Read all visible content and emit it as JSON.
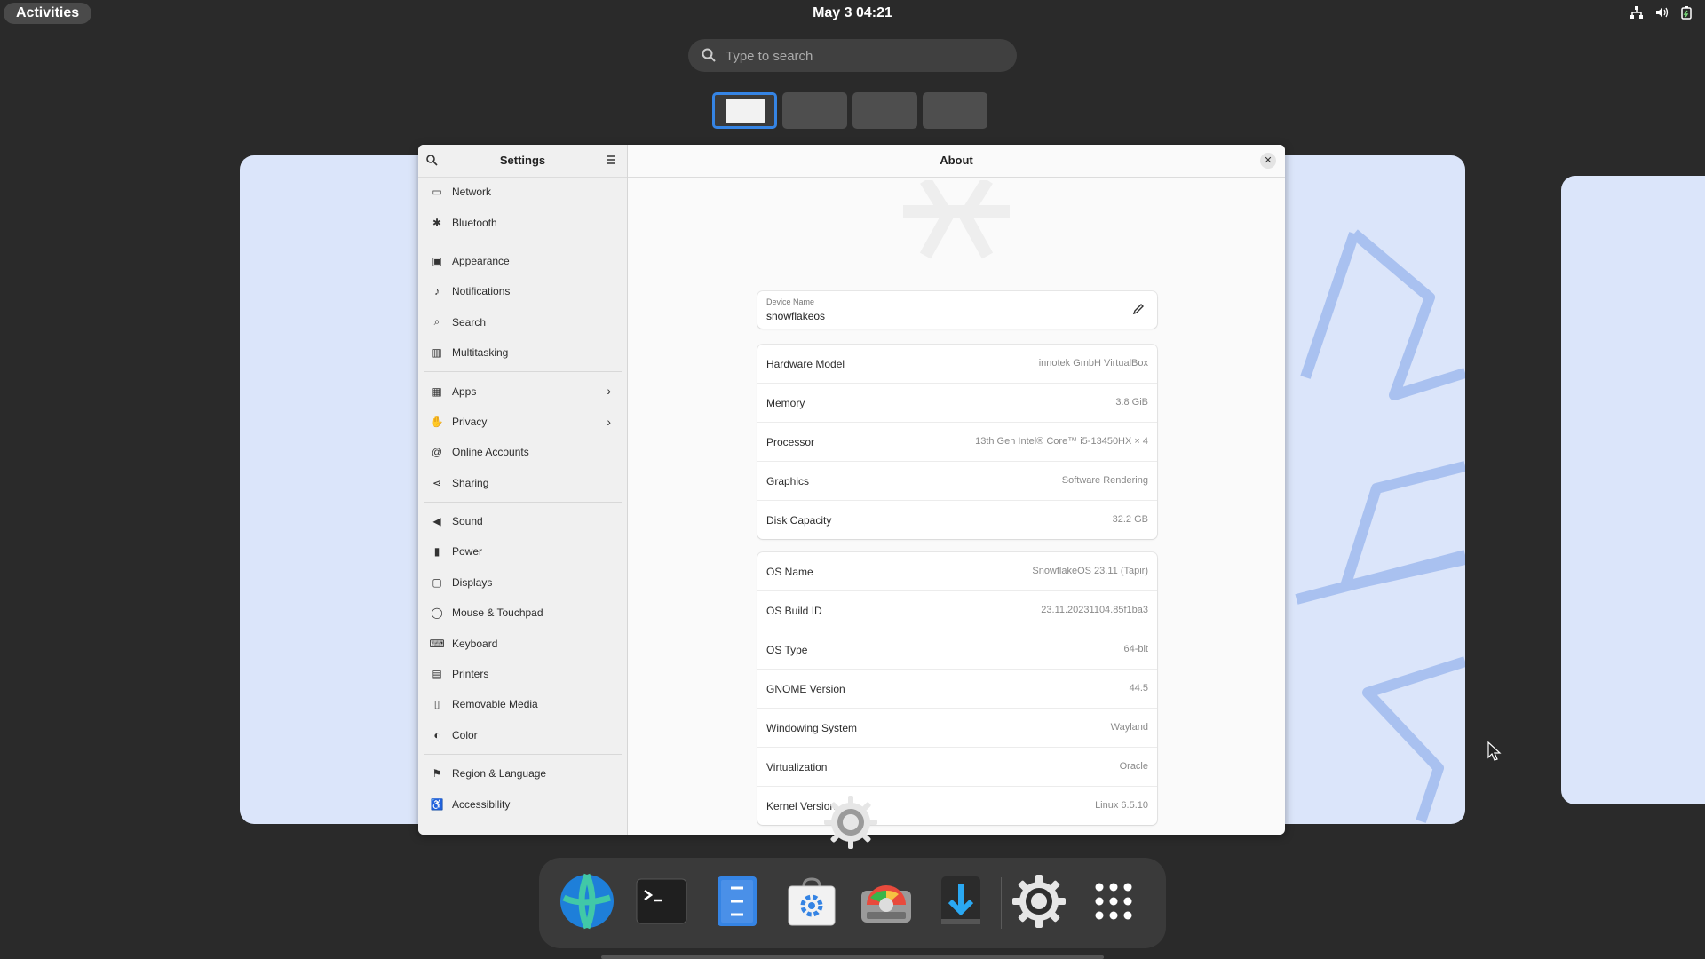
{
  "topbar": {
    "activities_label": "Activities",
    "clock": "May 3  04:21",
    "tray_icons": [
      "network-icon",
      "volume-icon",
      "battery-icon"
    ]
  },
  "search": {
    "placeholder": "Type to search"
  },
  "workspaces": {
    "count": 4,
    "active_index": 0
  },
  "settings": {
    "sidebar_title": "Settings",
    "groups": [
      [
        {
          "label": "Network",
          "icon": "network-icon"
        },
        {
          "label": "Bluetooth",
          "icon": "bluetooth-icon"
        }
      ],
      [
        {
          "label": "Appearance",
          "icon": "appearance-icon"
        },
        {
          "label": "Notifications",
          "icon": "bell-icon"
        },
        {
          "label": "Search",
          "icon": "search-icon"
        },
        {
          "label": "Multitasking",
          "icon": "multitasking-icon"
        }
      ],
      [
        {
          "label": "Apps",
          "icon": "apps-icon",
          "chevron": true
        },
        {
          "label": "Privacy",
          "icon": "hand-icon",
          "chevron": true
        },
        {
          "label": "Online Accounts",
          "icon": "at-icon"
        },
        {
          "label": "Sharing",
          "icon": "share-icon"
        }
      ],
      [
        {
          "label": "Sound",
          "icon": "speaker-icon"
        },
        {
          "label": "Power",
          "icon": "power-icon"
        },
        {
          "label": "Displays",
          "icon": "display-icon"
        },
        {
          "label": "Mouse & Touchpad",
          "icon": "mouse-icon"
        },
        {
          "label": "Keyboard",
          "icon": "keyboard-icon"
        },
        {
          "label": "Printers",
          "icon": "printer-icon"
        },
        {
          "label": "Removable Media",
          "icon": "usb-icon"
        },
        {
          "label": "Color",
          "icon": "color-icon"
        }
      ],
      [
        {
          "label": "Region & Language",
          "icon": "flag-icon"
        },
        {
          "label": "Accessibility",
          "icon": "accessibility-icon"
        }
      ]
    ],
    "page_title": "About",
    "device": {
      "label": "Device Name",
      "value": "snowflakeos"
    },
    "hardware": [
      {
        "key": "Hardware Model",
        "value": "innotek GmbH VirtualBox"
      },
      {
        "key": "Memory",
        "value": "3.8 GiB"
      },
      {
        "key": "Processor",
        "value": "13th Gen Intel® Core™ i5-13450HX × 4"
      },
      {
        "key": "Graphics",
        "value": "Software Rendering"
      },
      {
        "key": "Disk Capacity",
        "value": "32.2 GB"
      }
    ],
    "os": [
      {
        "key": "OS Name",
        "value": "SnowflakeOS 23.11 (Tapir)"
      },
      {
        "key": "OS Build ID",
        "value": "23.11.20231104.85f1ba3"
      },
      {
        "key": "OS Type",
        "value": "64-bit"
      },
      {
        "key": "GNOME Version",
        "value": "44.5"
      },
      {
        "key": "Windowing System",
        "value": "Wayland"
      },
      {
        "key": "Virtualization",
        "value": "Oracle"
      },
      {
        "key": "Kernel Version",
        "value": "Linux 6.5.10"
      }
    ]
  },
  "dock": {
    "apps": [
      "browser-icon",
      "terminal-icon",
      "files-icon",
      "software-store-icon",
      "disk-usage-icon",
      "downloader-icon",
      "settings-gear-icon",
      "app-grid-icon"
    ]
  },
  "colors": {
    "accent": "#3584e4",
    "workspace_bg": "#dbe5fa",
    "shell_bg": "#2a2a2a"
  }
}
